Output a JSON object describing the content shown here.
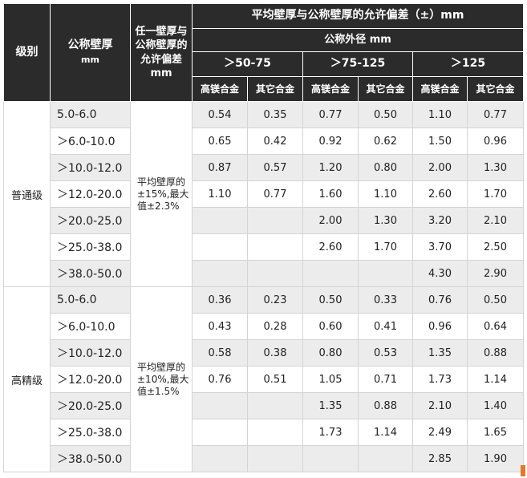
{
  "header": {
    "grade": "级别",
    "nominal_thickness": "公称壁厚",
    "nominal_thickness_unit": "mm",
    "any_wall_tolerance": "任一壁厚与公称壁厚的允许偏差mm",
    "avg_wall_tolerance": "平均壁厚与公称壁厚的允许偏差（±）mm",
    "outer_diameter": "公称外径 mm",
    "od_ranges": [
      "＞50-75",
      "＞75-125",
      "＞125"
    ],
    "alloys": [
      "高镁合金",
      "其它合金",
      "高镁合金",
      "其它合金",
      "高镁合金",
      "其它合金"
    ]
  },
  "groups": [
    {
      "grade": "普通级",
      "note": "平均壁厚的±15%,最大值±2.3%",
      "rows": [
        {
          "thk": "5.0-6.0",
          "v": [
            "0.54",
            "0.35",
            "0.77",
            "0.50",
            "1.10",
            "0.77"
          ]
        },
        {
          "thk": "＞6.0-10.0",
          "v": [
            "0.65",
            "0.42",
            "0.92",
            "0.62",
            "1.50",
            "0.96"
          ]
        },
        {
          "thk": "＞10.0-12.0",
          "v": [
            "0.87",
            "0.57",
            "1.20",
            "0.80",
            "2.00",
            "1.30"
          ]
        },
        {
          "thk": "＞12.0-20.0",
          "v": [
            "1.10",
            "0.77",
            "1.60",
            "1.10",
            "2.60",
            "1.70"
          ]
        },
        {
          "thk": "＞20.0-25.0",
          "v": [
            "",
            "",
            "2.00",
            "1.30",
            "3.20",
            "2.10"
          ]
        },
        {
          "thk": "＞25.0-38.0",
          "v": [
            "",
            "",
            "2.60",
            "1.70",
            "3.70",
            "2.50"
          ]
        },
        {
          "thk": "＞38.0-50.0",
          "v": [
            "",
            "",
            "",
            "",
            "4.30",
            "2.90"
          ]
        }
      ]
    },
    {
      "grade": "高精级",
      "note": "平均壁厚的±10%,最大值±1.5%",
      "rows": [
        {
          "thk": "5.0-6.0",
          "v": [
            "0.36",
            "0.23",
            "0.50",
            "0.33",
            "0.76",
            "0.50"
          ]
        },
        {
          "thk": "＞6.0-10.0",
          "v": [
            "0.43",
            "0.28",
            "0.60",
            "0.41",
            "0.96",
            "0.64"
          ]
        },
        {
          "thk": "＞10.0-12.0",
          "v": [
            "0.58",
            "0.38",
            "0.80",
            "0.53",
            "1.35",
            "0.88"
          ]
        },
        {
          "thk": "＞12.0-20.0",
          "v": [
            "0.76",
            "0.51",
            "1.05",
            "0.71",
            "1.73",
            "1.14"
          ]
        },
        {
          "thk": "＞20.0-25.0",
          "v": [
            "",
            "",
            "1.35",
            "0.88",
            "2.10",
            "1.40"
          ]
        },
        {
          "thk": "＞25.0-38.0",
          "v": [
            "",
            "",
            "1.73",
            "1.14",
            "2.49",
            "1.65"
          ]
        },
        {
          "thk": "＞38.0-50.0",
          "v": [
            "",
            "",
            "",
            "",
            "2.85",
            "1.90"
          ]
        }
      ]
    }
  ]
}
